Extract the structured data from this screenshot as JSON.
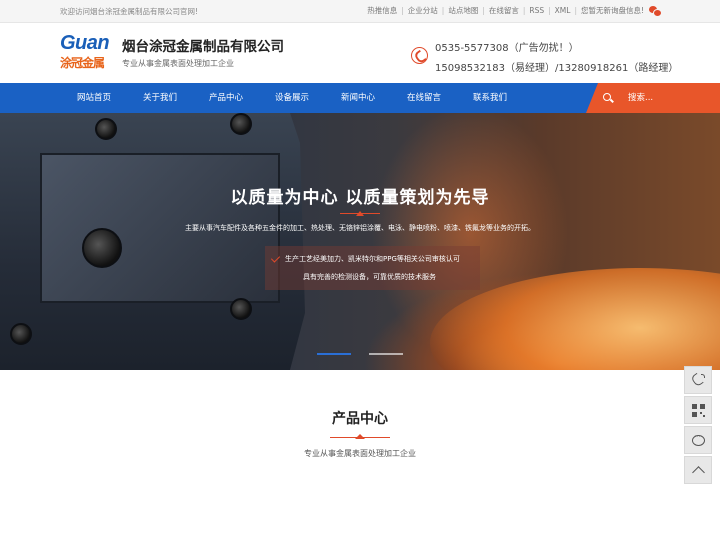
{
  "topbar": {
    "welcome": "欢迎访问烟台涂冠金属制品有限公司官网!",
    "links": [
      "热推信息",
      "企业分站",
      "站点地图",
      "在线留言",
      "RSS",
      "XML",
      "您暂无新询盘信息!"
    ]
  },
  "header": {
    "logo_en": "Guan",
    "logo_cn": "涂冠金属",
    "company_name": "烟台涂冠金属制品有限公司",
    "slogan": "专业从事金属表面处理加工企业",
    "hotline_1": "0535-5577308（广告勿扰！）",
    "hotline_2": "15098532183（易经理）/13280918261（路经理）"
  },
  "nav": {
    "items": [
      "网站首页",
      "关于我们",
      "产品中心",
      "设备展示",
      "新闻中心",
      "在线留言",
      "联系我们"
    ],
    "search_label": "搜索..."
  },
  "banner": {
    "title": "以质量为中心 以质量策划为先导",
    "description": "主要从事汽车配件及各种五金件的加工、热处理、无铬锌铝涂覆、电泳、静电喷粉、喷漆、铁氟龙等业务的开拓。",
    "feature_1": "生产工艺经美加力、凯米特尔和PPG等相关公司审核认可",
    "feature_2": "具有完善的检测设备，可靠优质的技术服务",
    "slide_count": 2,
    "active_slide": 1
  },
  "section": {
    "title": "产品中心",
    "subtitle": "专业从事金属表面处理加工企业"
  },
  "side_tools": [
    "phone-icon",
    "qrcode-icon",
    "chat-icon",
    "back-to-top-icon"
  ],
  "colors": {
    "nav_blue": "#1a61c4",
    "accent_orange": "#e8562a",
    "accent_red": "#e04a2a"
  }
}
